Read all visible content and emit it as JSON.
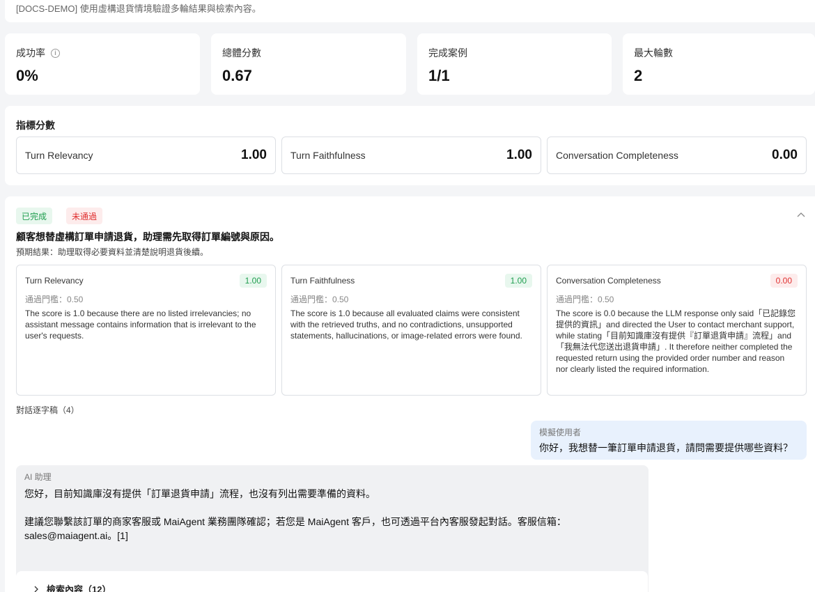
{
  "banner": {
    "description": "[DOCS-DEMO] 使用虛構退貨情境驗證多輪結果與檢索內容。"
  },
  "stats": [
    {
      "label": "成功率",
      "value": "0%",
      "has_info": true
    },
    {
      "label": "總體分數",
      "value": "0.67"
    },
    {
      "label": "完成案例",
      "value": "1/1"
    },
    {
      "label": "最大輪數",
      "value": "2"
    }
  ],
  "metrics": {
    "title": "指標分數",
    "items": [
      {
        "name": "Turn Relevancy",
        "value": "1.00"
      },
      {
        "name": "Turn Faithfulness",
        "value": "1.00"
      },
      {
        "name": "Conversation Completeness",
        "value": "0.00"
      }
    ]
  },
  "case": {
    "status_done": "已完成",
    "status_fail": "未通過",
    "title": "顧客想替虛構訂單申請退貨，助理需先取得訂單編號與原因。",
    "expected": "預期結果：助理取得必要資料並清楚說明退貨後續。",
    "evaluations": [
      {
        "name": "Turn Relevancy",
        "score": "1.00",
        "passed": true,
        "threshold": "通過門檻：0.50",
        "reason": "The score is 1.0 because there are no listed irrelevancies; no assistant message contains information that is irrelevant to the user's requests."
      },
      {
        "name": "Turn Faithfulness",
        "score": "1.00",
        "passed": true,
        "threshold": "通過門檻：0.50",
        "reason": "The score is 1.0 because all evaluated claims were consistent with the retrieved truths, and no contradictions, unsupported statements, hallucinations, or image-related errors were found."
      },
      {
        "name": "Conversation Completeness",
        "score": "0.00",
        "passed": false,
        "threshold": "通過門檻：0.50",
        "reason": "The score is 0.0 because the LLM response only said「已記錄您提供的資訊」and directed the User to contact merchant support, while stating「目前知識庫沒有提供『訂單退貨申請』流程」and「我無法代您送出退貨申請」. It therefore neither completed the requested return using the provided order number and reason nor clearly listed the required information."
      }
    ],
    "transcript_label": "對話逐字稿（4）",
    "messages": {
      "user_role": "模擬使用者",
      "user_text": "你好，我想替一筆訂單申請退貨，請問需要提供哪些資料？",
      "ai_role": "AI 助理",
      "ai_text": " 您好，目前知識庫沒有提供「訂單退貨申請」流程，也沒有列出需要準備的資料。\n\n建議您聯繫該訂單的商家客服或 MaiAgent 業務團隊確認；若您是 MaiAgent 客戶，也可透過平台內客服發起對話。客服信箱：sales@maiagent.ai。[1]"
    },
    "retrieval_label": "檢索內容（12）"
  }
}
